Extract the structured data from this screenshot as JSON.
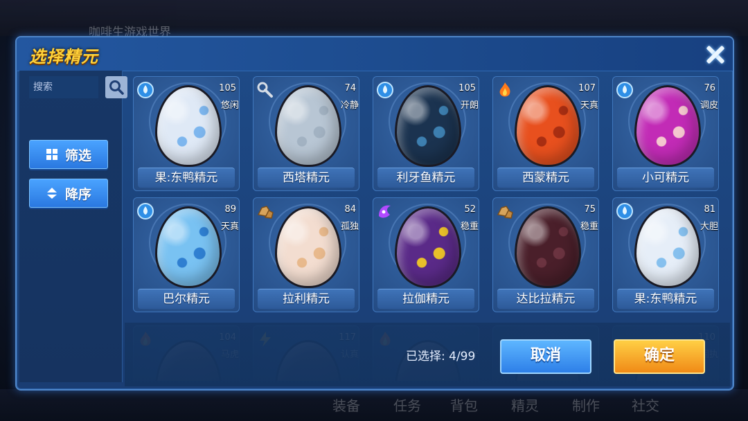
{
  "background": {
    "top_text": "咖啡生游戏世界",
    "bottom_items": [
      "装备",
      "任务",
      "背包",
      "精灵",
      "制作",
      "社交"
    ]
  },
  "dialog": {
    "title": "选择精元",
    "close_icon": "close-icon"
  },
  "sidebar": {
    "search_placeholder": "搜索",
    "filter_label": "筛选",
    "sort_label": "降序"
  },
  "eggs": [
    {
      "name": "果:东鸭精元",
      "level": "105",
      "nature": "悠闲",
      "type": "water",
      "base": "#dfe9f6",
      "spot": "#7db6ee"
    },
    {
      "name": "西塔精元",
      "level": "74",
      "nature": "冷静",
      "type": "wrench",
      "base": "#b8c6d4",
      "spot": "#a2b2c2"
    },
    {
      "name": "利牙鱼精元",
      "level": "105",
      "nature": "开朗",
      "type": "water",
      "base": "#1b3350",
      "spot": "#3d7fb0"
    },
    {
      "name": "西蒙精元",
      "level": "107",
      "nature": "天真",
      "type": "fire",
      "base": "#e8501e",
      "spot": "#a82e12"
    },
    {
      "name": "小可精元",
      "level": "76",
      "nature": "调皮",
      "type": "water",
      "base": "#c22bb6",
      "spot": "#f4c7cf"
    },
    {
      "name": "巴尔精元",
      "level": "89",
      "nature": "天真",
      "type": "water",
      "base": "#79c2f2",
      "spot": "#2f7fd1"
    },
    {
      "name": "拉利精元",
      "level": "84",
      "nature": "孤独",
      "type": "rock",
      "base": "#f3ddd0",
      "spot": "#e8b98c"
    },
    {
      "name": "拉伽精元",
      "level": "52",
      "nature": "稳重",
      "type": "ghost",
      "base": "#5a2a88",
      "spot": "#e9c02a"
    },
    {
      "name": "达比拉精元",
      "level": "75",
      "nature": "稳重",
      "type": "rock",
      "base": "#4a1f2a",
      "spot": "#6b3340"
    },
    {
      "name": "果:东鸭精元",
      "level": "81",
      "nature": "大胆",
      "type": "water",
      "base": "#e6eef8",
      "spot": "#86c0ee"
    }
  ],
  "partial_row": [
    {
      "level": "104",
      "nature": "马虎",
      "type": "fire"
    },
    {
      "level": "117",
      "nature": "认真",
      "type": "electric"
    },
    {
      "level": "",
      "nature": "保守",
      "type": "fire"
    },
    {
      "level": "",
      "nature": "",
      "type": ""
    },
    {
      "level": "110",
      "nature": "固执",
      "type": ""
    }
  ],
  "footer": {
    "selected_text": "已选择: 4/99",
    "cancel_label": "取消",
    "confirm_label": "确定"
  },
  "colors": {
    "title": "#ffd23a",
    "cancel": "#2d7fe8",
    "confirm": "#f08a16"
  }
}
